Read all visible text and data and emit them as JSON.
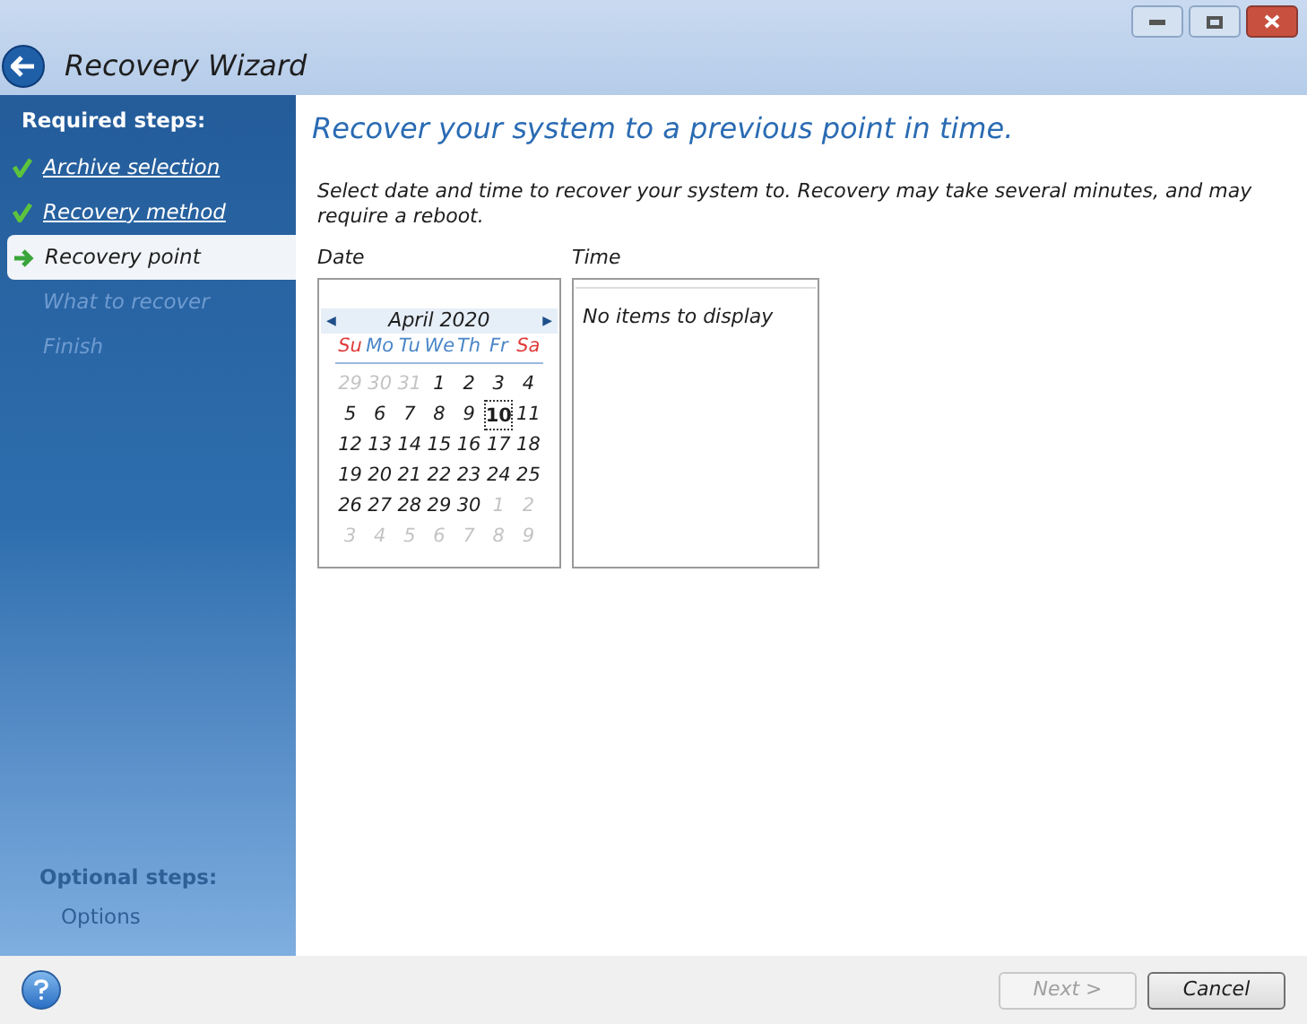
{
  "window": {
    "title": "Recovery Wizard"
  },
  "sidebar": {
    "heading": "Required steps:",
    "steps": [
      {
        "label": "Archive selection",
        "kind": "done"
      },
      {
        "label": "Recovery method",
        "kind": "done"
      },
      {
        "label": "Recovery point",
        "kind": "current"
      },
      {
        "label": "What to recover",
        "kind": "pending"
      },
      {
        "label": "Finish",
        "kind": "pending"
      }
    ],
    "optional_heading": "Optional steps:",
    "optional_steps": [
      "Options"
    ]
  },
  "content": {
    "title": "Recover your system to a previous point in time.",
    "description": "Select date and time to recover your system to. Recovery may take several minutes, and may require a reboot.",
    "date_label": "Date",
    "time_label": "Time",
    "calendar": {
      "month": "April 2020",
      "prev": "◀",
      "next": "▶",
      "weekdays": [
        {
          "label": "Su",
          "weekend": true
        },
        {
          "label": "Mo",
          "weekend": false
        },
        {
          "label": "Tu",
          "weekend": false
        },
        {
          "label": "We",
          "weekend": false
        },
        {
          "label": "Th",
          "weekend": false
        },
        {
          "label": "Fr",
          "weekend": false
        },
        {
          "label": "Sa",
          "weekend": true
        }
      ],
      "days": [
        {
          "label": "29",
          "muted": true,
          "selected": false
        },
        {
          "label": "30",
          "muted": true,
          "selected": false
        },
        {
          "label": "31",
          "muted": true,
          "selected": false
        },
        {
          "label": "1",
          "muted": false,
          "selected": false
        },
        {
          "label": "2",
          "muted": false,
          "selected": false
        },
        {
          "label": "3",
          "muted": false,
          "selected": false
        },
        {
          "label": "4",
          "muted": false,
          "selected": false
        },
        {
          "label": "5",
          "muted": false,
          "selected": false
        },
        {
          "label": "6",
          "muted": false,
          "selected": false
        },
        {
          "label": "7",
          "muted": false,
          "selected": false
        },
        {
          "label": "8",
          "muted": false,
          "selected": false
        },
        {
          "label": "9",
          "muted": false,
          "selected": false
        },
        {
          "label": "10",
          "muted": false,
          "selected": true
        },
        {
          "label": "11",
          "muted": false,
          "selected": false
        },
        {
          "label": "12",
          "muted": false,
          "selected": false
        },
        {
          "label": "13",
          "muted": false,
          "selected": false
        },
        {
          "label": "14",
          "muted": false,
          "selected": false
        },
        {
          "label": "15",
          "muted": false,
          "selected": false
        },
        {
          "label": "16",
          "muted": false,
          "selected": false
        },
        {
          "label": "17",
          "muted": false,
          "selected": false
        },
        {
          "label": "18",
          "muted": false,
          "selected": false
        },
        {
          "label": "19",
          "muted": false,
          "selected": false
        },
        {
          "label": "20",
          "muted": false,
          "selected": false
        },
        {
          "label": "21",
          "muted": false,
          "selected": false
        },
        {
          "label": "22",
          "muted": false,
          "selected": false
        },
        {
          "label": "23",
          "muted": false,
          "selected": false
        },
        {
          "label": "24",
          "muted": false,
          "selected": false
        },
        {
          "label": "25",
          "muted": false,
          "selected": false
        },
        {
          "label": "26",
          "muted": false,
          "selected": false
        },
        {
          "label": "27",
          "muted": false,
          "selected": false
        },
        {
          "label": "28",
          "muted": false,
          "selected": false
        },
        {
          "label": "29",
          "muted": false,
          "selected": false
        },
        {
          "label": "30",
          "muted": false,
          "selected": false
        },
        {
          "label": "1",
          "muted": true,
          "selected": false
        },
        {
          "label": "2",
          "muted": true,
          "selected": false
        },
        {
          "label": "3",
          "muted": true,
          "selected": false
        },
        {
          "label": "4",
          "muted": true,
          "selected": false
        },
        {
          "label": "5",
          "muted": true,
          "selected": false
        },
        {
          "label": "6",
          "muted": true,
          "selected": false
        },
        {
          "label": "7",
          "muted": true,
          "selected": false
        },
        {
          "label": "8",
          "muted": true,
          "selected": false
        },
        {
          "label": "9",
          "muted": true,
          "selected": false
        }
      ]
    },
    "time_list": {
      "empty_text": "No items to display"
    }
  },
  "footer": {
    "buttons": [
      {
        "label": "Next >",
        "disabled": true
      },
      {
        "label": "Cancel",
        "disabled": false
      }
    ]
  }
}
